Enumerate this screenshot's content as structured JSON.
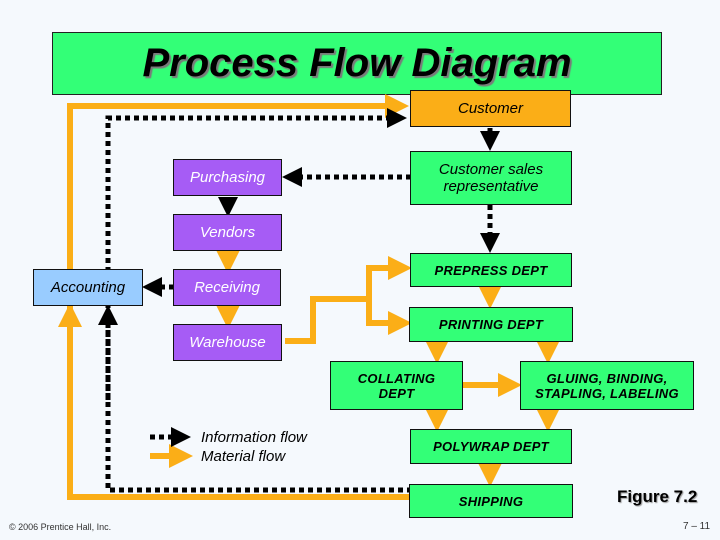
{
  "title": "Process Flow Diagram",
  "nodes": {
    "customer": "Customer",
    "purchasing": "Purchasing",
    "csr": "Customer sales representative",
    "vendors": "Vendors",
    "accounting": "Accounting",
    "receiving": "Receiving",
    "warehouse": "Warehouse",
    "prepress": "PREPRESS DEPT",
    "printing": "PRINTING DEPT",
    "collating": "COLLATING DEPT",
    "gluing": "GLUING, BINDING, STAPLING, LABELING",
    "polywrap": "POLYWRAP DEPT",
    "shipping": "SHIPPING"
  },
  "legend": {
    "information": "Information flow",
    "material": "Material flow"
  },
  "colors": {
    "information_flow": "#000000",
    "material_flow": "#fbae17",
    "title_bg": "#33ff77",
    "dept_green": "#33ff77",
    "purple": "#a65cf5",
    "customer_orange": "#fbae17",
    "accounting_blue": "#99ccff"
  },
  "figure_label": "Figure 7.2",
  "page_number": "7 – 11",
  "copyright": "© 2006 Prentice Hall, Inc."
}
